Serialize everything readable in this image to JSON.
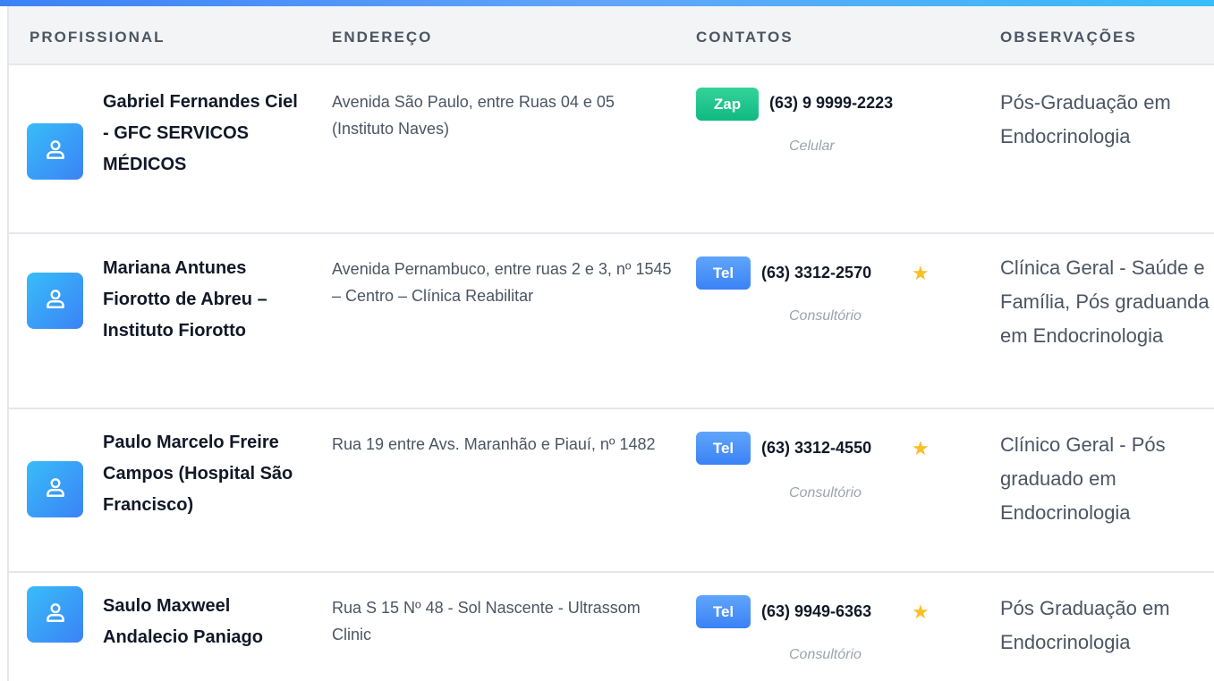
{
  "headers": {
    "professional": "PROFISSIONAL",
    "address": "ENDEREÇO",
    "contacts": "CONTATOS",
    "observations": "OBSERVAÇÕES"
  },
  "rows": [
    {
      "name": "Gabriel Fernandes Ciel - GFC SERVICOS MÉDICOS",
      "address": "Avenida São Paulo, entre Ruas 04 e 05 (Instituto Naves)",
      "badge": "Zap",
      "badge_type": "whatsapp",
      "phone": "(63) 9 9999-2223",
      "phone_type": "Celular",
      "starred": false,
      "obs": "Pós-Graduação em Endocrinologia"
    },
    {
      "name": "Mariana Antunes Fiorotto de Abreu – Instituto Fiorotto",
      "address": "Avenida Pernambuco, entre ruas 2 e 3, nº 1545 – Centro – Clínica Reabilitar",
      "badge": "Tel",
      "badge_type": "phone",
      "phone": "(63) 3312-2570",
      "phone_type": "Consultório",
      "starred": true,
      "obs": "Clínica Geral - Saúde e Família, Pós graduanda em Endocrinologia"
    },
    {
      "name": "Paulo Marcelo Freire Campos (Hospital São Francisco)",
      "address": "Rua 19 entre Avs. Maranhão e Piauí, nº 1482",
      "badge": "Tel",
      "badge_type": "phone",
      "phone": "(63) 3312-4550",
      "phone_type": "Consultório",
      "starred": true,
      "obs": "Clínico Geral - Pós graduado em Endocrinologia"
    },
    {
      "name": "Saulo Maxweel Andalecio Paniago",
      "address": "Rua S 15 Nº 48 - Sol Nascente - Ultrassom Clinic",
      "badge": "Tel",
      "badge_type": "phone",
      "phone": "(63) 9949-6363",
      "phone_type": "Consultório",
      "starred": true,
      "obs": "Pós Graduação em Endocrinologia"
    }
  ],
  "icons": {
    "avatar": "user-icon",
    "star": "star-icon"
  },
  "colors": {
    "accent": "#3b82f6",
    "whatsapp": "#10b981",
    "star": "#fbbf24"
  }
}
